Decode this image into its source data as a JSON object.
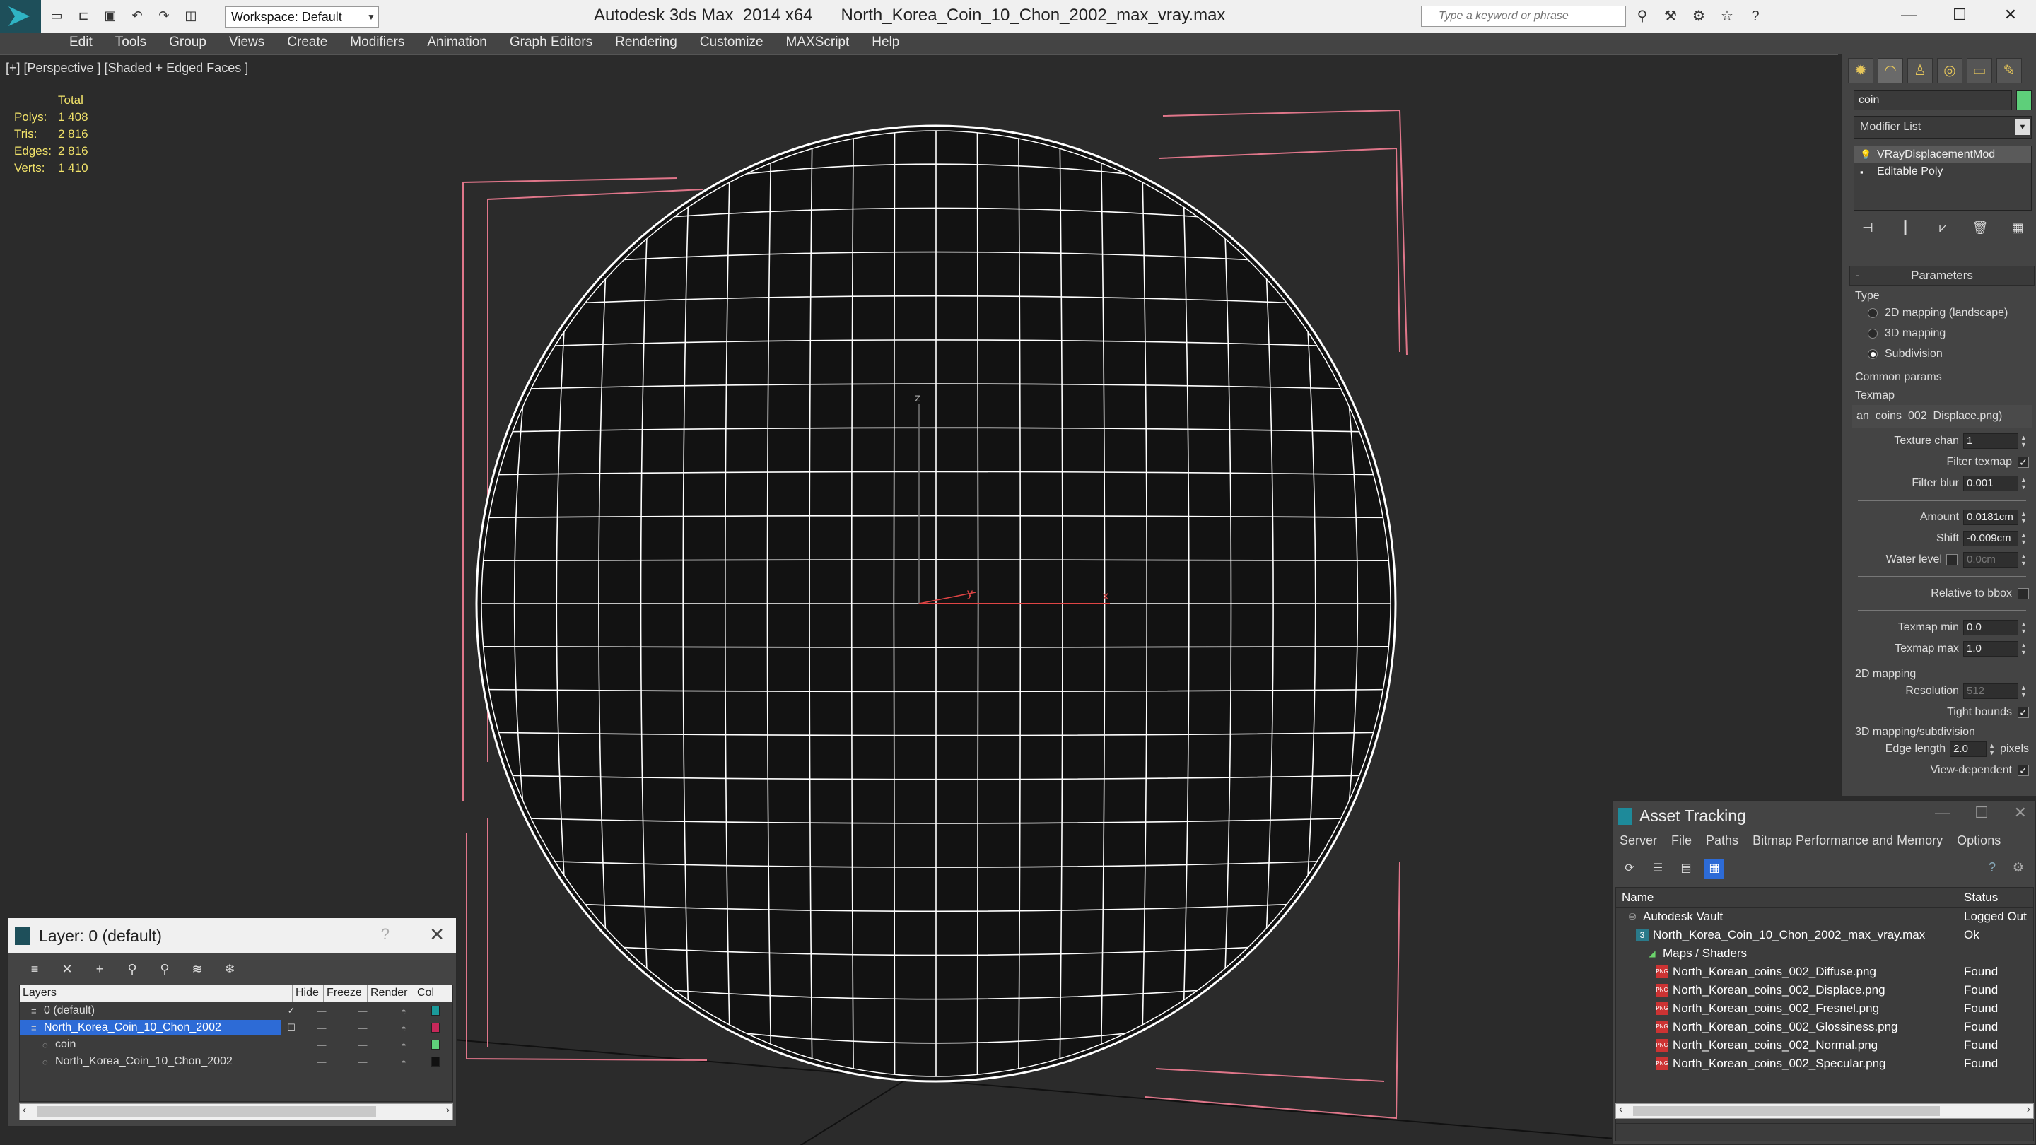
{
  "titlebar": {
    "workspace": "Workspace: Default",
    "title": "Autodesk 3ds Max  2014 x64      North_Korea_Coin_10_Chon_2002_max_vray.max",
    "search_placeholder": "Type a keyword or phrase"
  },
  "menu": [
    "Edit",
    "Tools",
    "Group",
    "Views",
    "Create",
    "Modifiers",
    "Animation",
    "Graph Editors",
    "Rendering",
    "Customize",
    "MAXScript",
    "Help"
  ],
  "viewport": {
    "label": "[+] [Perspective ] [Shaded + Edged Faces ]",
    "stats": {
      "header": "Total",
      "rows": [
        {
          "label": "Polys:",
          "value": "1 408"
        },
        {
          "label": "Tris:",
          "value": "2 816"
        },
        {
          "label": "Edges:",
          "value": "2 816"
        },
        {
          "label": "Verts:",
          "value": "1 410"
        }
      ]
    },
    "axis": {
      "z": "z",
      "y": "y",
      "x": "x"
    }
  },
  "command_panel": {
    "object_name": "coin",
    "object_color": "#5ecf7a",
    "modifier_list": "Modifier List",
    "stack": [
      {
        "label": "VRayDisplacementMod",
        "selected": true
      },
      {
        "label": "Editable Poly",
        "selected": false
      }
    ],
    "params": {
      "title": "Parameters",
      "type_label": "Type",
      "types": [
        {
          "label": "2D mapping (landscape)",
          "on": false
        },
        {
          "label": "3D mapping",
          "on": false
        },
        {
          "label": "Subdivision",
          "on": true
        }
      ],
      "common_label": "Common params",
      "texmap_label": "Texmap",
      "texmap_value": "an_coins_002_Displace.png)",
      "texture_chan_label": "Texture chan",
      "texture_chan": "1",
      "filter_texmap_label": "Filter texmap",
      "filter_blur_label": "Filter blur",
      "filter_blur": "0.001",
      "amount_label": "Amount",
      "amount": "0.0181cm",
      "shift_label": "Shift",
      "shift": "-0.009cm",
      "water_label": "Water level",
      "water": "0.0cm",
      "rel_bbox_label": "Relative to bbox",
      "texmap_min_label": "Texmap min",
      "texmap_min": "0.0",
      "texmap_max_label": "Texmap max",
      "texmap_max": "1.0",
      "mapping2d_label": "2D mapping",
      "resolution_label": "Resolution",
      "resolution": "512",
      "tight_label": "Tight bounds",
      "mapping3d_label": "3D mapping/subdivision",
      "edge_label": "Edge length",
      "edge": "2.0",
      "pixels_label": "pixels",
      "view_dep_label": "View-dependent"
    }
  },
  "layer_window": {
    "title": "Layer: 0 (default)",
    "help": "?",
    "columns": [
      "Layers",
      "Hide",
      "Freeze",
      "Render",
      "Col"
    ],
    "rows": [
      {
        "name": "0 (default)",
        "indent": 1,
        "color": "#1a9a9a",
        "selected": false,
        "check": "✓"
      },
      {
        "name": "North_Korea_Coin_10_Chon_2002",
        "indent": 1,
        "color": "#c8285a",
        "selected": true,
        "check": "☐"
      },
      {
        "name": "coin",
        "indent": 2,
        "color": "#5ecf7a",
        "selected": false,
        "check": ""
      },
      {
        "name": "North_Korea_Coin_10_Chon_2002",
        "indent": 2,
        "color": "#111111",
        "selected": false,
        "check": ""
      }
    ]
  },
  "asset_window": {
    "title": "Asset Tracking",
    "menu": [
      "Server",
      "File",
      "Paths",
      "Bitmap Performance and Memory",
      "Options"
    ],
    "columns": {
      "name": "Name",
      "status": "Status"
    },
    "rows": [
      {
        "name": "Autodesk Vault",
        "status": "Logged Out",
        "indent": 1,
        "icon": "vault"
      },
      {
        "name": "North_Korea_Coin_10_Chon_2002_max_vray.max",
        "status": "Ok",
        "indent": 2,
        "icon": "maxf"
      },
      {
        "name": "Maps / Shaders",
        "status": "",
        "indent": 3,
        "icon": "map"
      },
      {
        "name": "North_Korean_coins_002_Diffuse.png",
        "status": "Found",
        "indent": 4,
        "icon": "png"
      },
      {
        "name": "North_Korean_coins_002_Displace.png",
        "status": "Found",
        "indent": 4,
        "icon": "png"
      },
      {
        "name": "North_Korean_coins_002_Fresnel.png",
        "status": "Found",
        "indent": 4,
        "icon": "png"
      },
      {
        "name": "North_Korean_coins_002_Glossiness.png",
        "status": "Found",
        "indent": 4,
        "icon": "png"
      },
      {
        "name": "North_Korean_coins_002_Normal.png",
        "status": "Found",
        "indent": 4,
        "icon": "png"
      },
      {
        "name": "North_Korean_coins_002_Specular.png",
        "status": "Found",
        "indent": 4,
        "icon": "png"
      }
    ]
  }
}
